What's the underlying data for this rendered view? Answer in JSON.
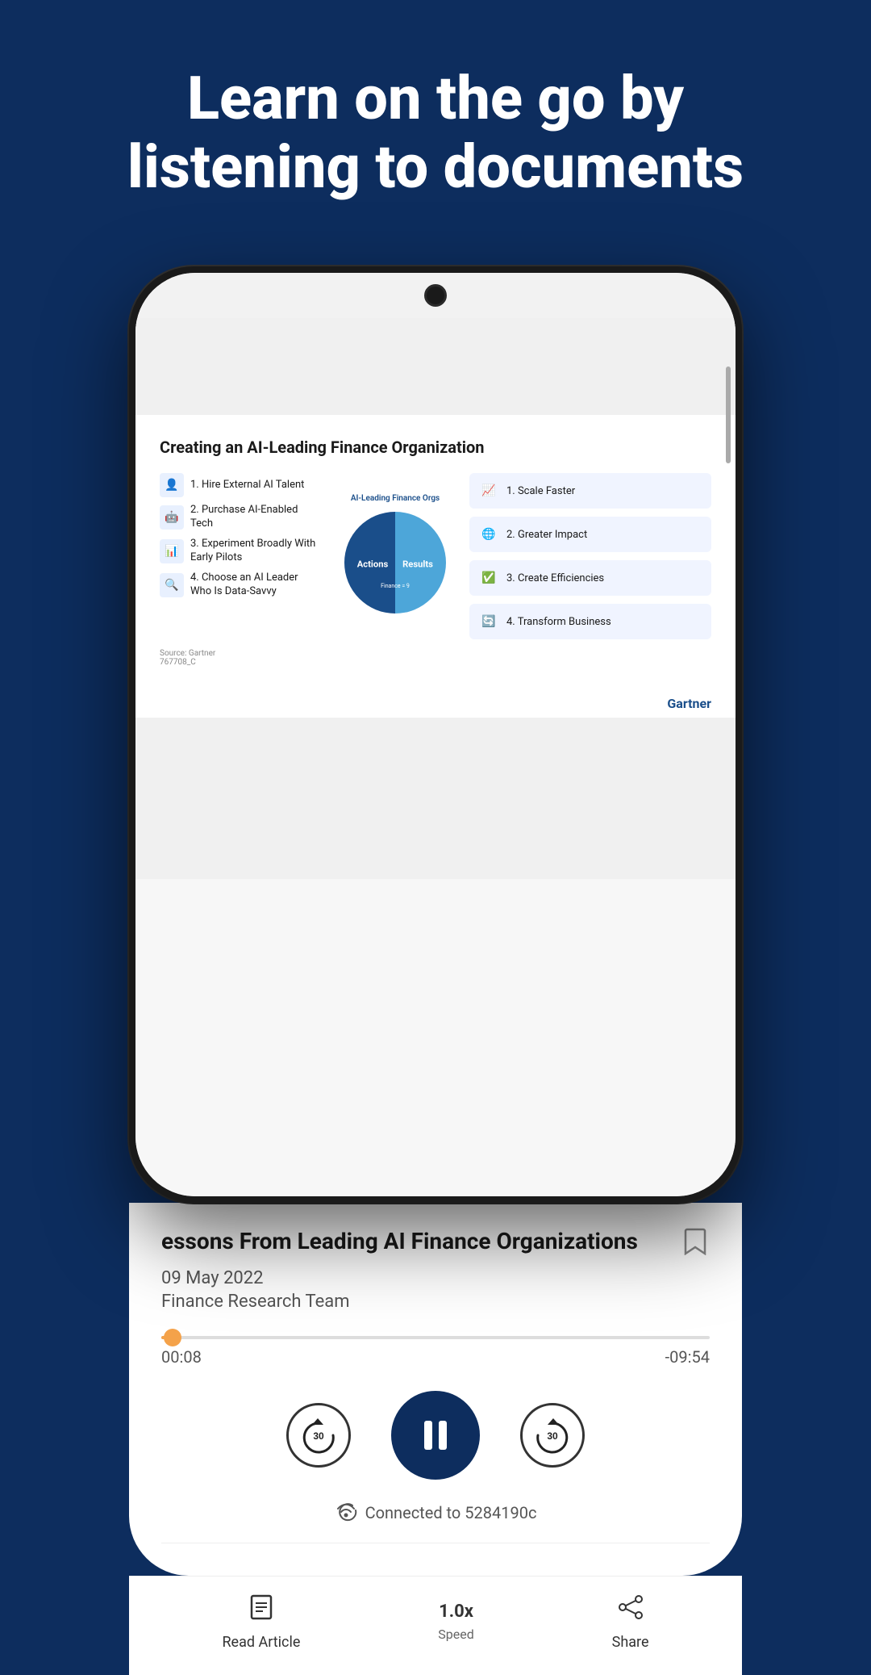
{
  "header": {
    "title": "Learn on the go by listening to documents"
  },
  "phone": {
    "doc": {
      "title": "Creating an AI-Leading Finance Organization",
      "actions": [
        {
          "icon": "👤",
          "text": "1. Hire External AI Talent"
        },
        {
          "icon": "🤖",
          "text": "2. Purchase AI-Enabled Tech"
        },
        {
          "icon": "📊",
          "text": "3. Experiment Broadly With Early Pilots"
        },
        {
          "icon": "🔍",
          "text": "4. Choose an AI Leader Who Is Data-Savvy"
        }
      ],
      "pie_label": "AI-Leading Finance Orgs",
      "pie_left": "Actions",
      "pie_right": "Results",
      "finance_note": "Finance = 9",
      "results": [
        {
          "icon": "📈",
          "text": "1. Scale Faster"
        },
        {
          "icon": "🌐",
          "text": "2. Greater Impact"
        },
        {
          "icon": "✅",
          "text": "3. Create Efficiencies"
        },
        {
          "icon": "🔄",
          "text": "4. Transform Business"
        }
      ],
      "source": "Source: Gartner\n767708_C",
      "brand": "Gartner"
    },
    "article": {
      "title": "essons From Leading AI Finance Organizations",
      "bookmark_icon": "🔖",
      "date": "09 May 2022",
      "author": "Finance Research Team",
      "progress_pct": 2,
      "time_current": "00:08",
      "time_remaining": "-09:54",
      "skip_back": "30",
      "skip_forward": "30",
      "connected_text": "Connected to 5284190c"
    }
  },
  "bottom_nav": {
    "items": [
      {
        "icon": "📄",
        "label": "Read Article",
        "sublabel": ""
      },
      {
        "icon": "",
        "label": "1.0x",
        "sublabel": "Speed"
      },
      {
        "icon": "↗",
        "label": "Share",
        "sublabel": ""
      }
    ]
  }
}
